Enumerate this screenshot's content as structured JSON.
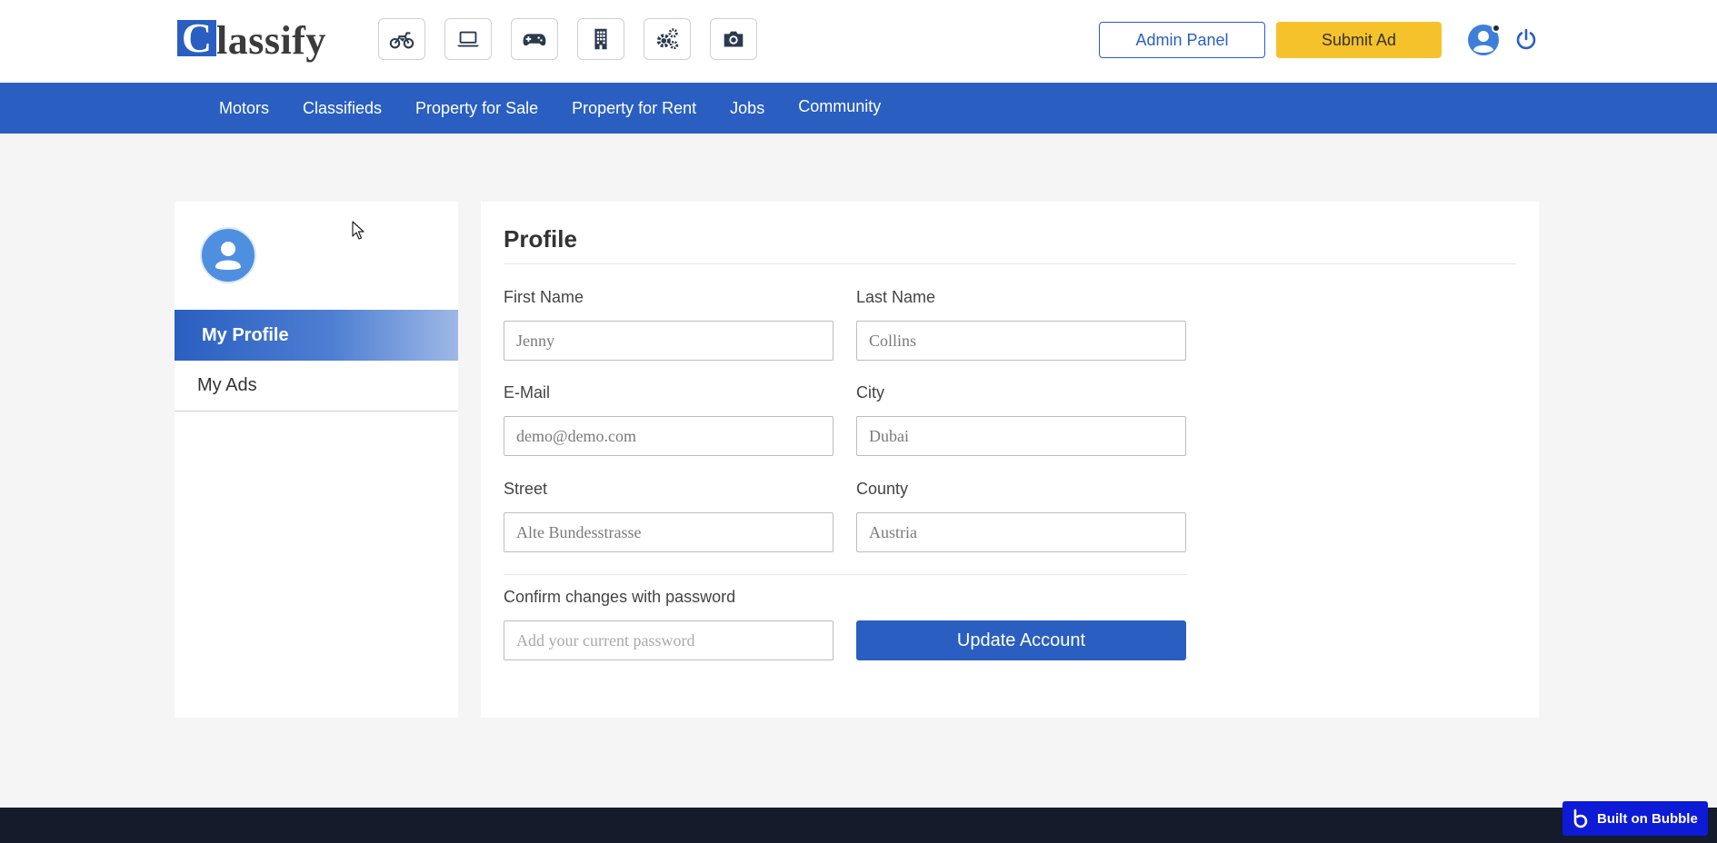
{
  "header": {
    "logo_letter": "C",
    "logo_text": "lassify",
    "category_icons": [
      "motorcycle-icon",
      "laptop-icon",
      "gamepad-icon",
      "building-icon",
      "gears-icon",
      "camera-icon"
    ],
    "admin_label": "Admin Panel",
    "submit_label": "Submit Ad"
  },
  "nav": {
    "items": [
      "Motors",
      "Classifieds",
      "Property for Sale",
      "Property for Rent",
      "Jobs",
      "Community"
    ]
  },
  "sidebar": {
    "items": [
      {
        "label": "My Profile",
        "active": true
      },
      {
        "label": "My Ads",
        "active": false
      }
    ]
  },
  "profile": {
    "title": "Profile",
    "first_name": {
      "label": "First Name",
      "value": "Jenny"
    },
    "last_name": {
      "label": "Last Name",
      "value": "Collins"
    },
    "email": {
      "label": "E-Mail",
      "value": "demo@demo.com"
    },
    "city": {
      "label": "City",
      "value": "Dubai"
    },
    "street": {
      "label": "Street",
      "value": "Alte Bundesstrasse"
    },
    "county": {
      "label": "County",
      "value": "Austria"
    },
    "password": {
      "label": "Confirm changes with password",
      "placeholder": "Add your current password"
    },
    "update_label": "Update Account"
  },
  "badge": {
    "label": "Built on Bubble"
  },
  "colors": {
    "primary": "#2a5fc1",
    "accent": "#f6c22c",
    "footer": "#141b2b",
    "bubble": "#0d1ad6"
  }
}
